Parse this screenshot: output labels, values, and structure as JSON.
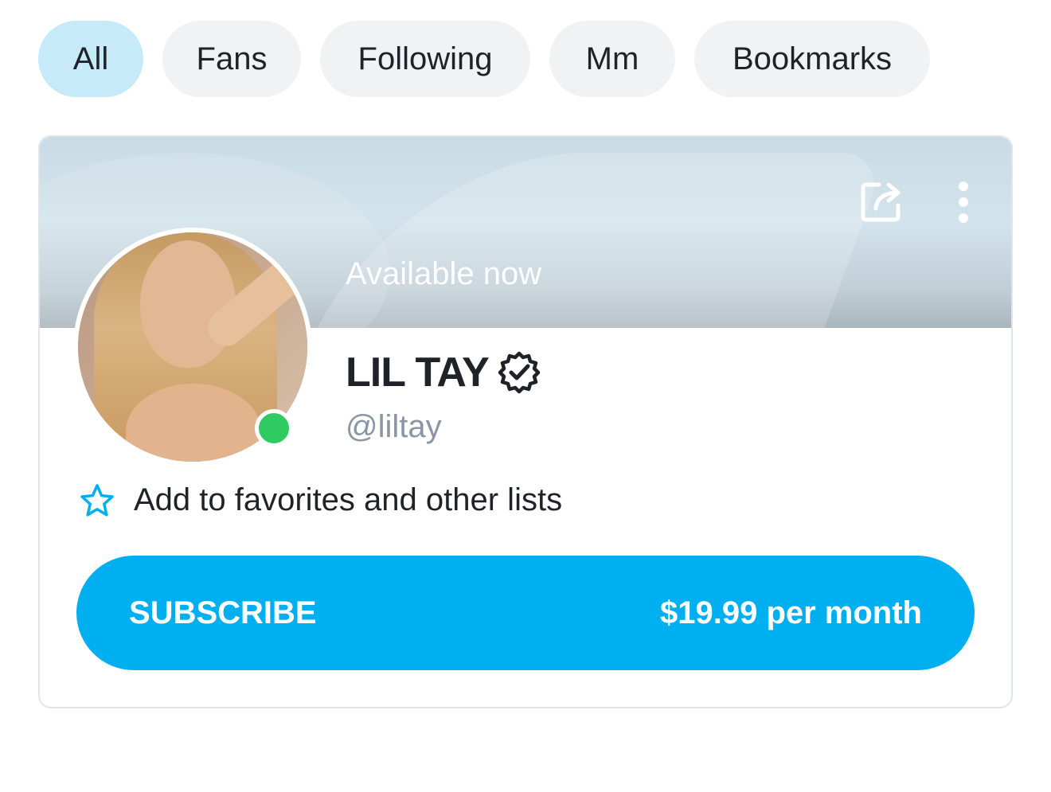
{
  "tabs": [
    {
      "label": "All",
      "active": true
    },
    {
      "label": "Fans",
      "active": false
    },
    {
      "label": "Following",
      "active": false
    },
    {
      "label": "Mm",
      "active": false
    },
    {
      "label": "Bookmarks",
      "active": false
    }
  ],
  "profile_card": {
    "status_text": "Available now",
    "display_name": "LIL TAY",
    "handle": "@liltay",
    "verified": true,
    "online": true,
    "favorites_label": "Add to favorites and other lists",
    "subscribe_label": "SUBSCRIBE",
    "subscribe_price": "$19.99 per month",
    "icons": {
      "share": "share-icon",
      "more": "more-vertical-icon",
      "verified": "verified-badge-icon",
      "favorite": "star-outline-icon"
    }
  },
  "colors": {
    "accent": "#00aff0",
    "active_tab_bg": "#c7eaf8",
    "tab_bg": "#f0f2f4",
    "online": "#2fca61",
    "muted_text": "#8a96a3"
  }
}
